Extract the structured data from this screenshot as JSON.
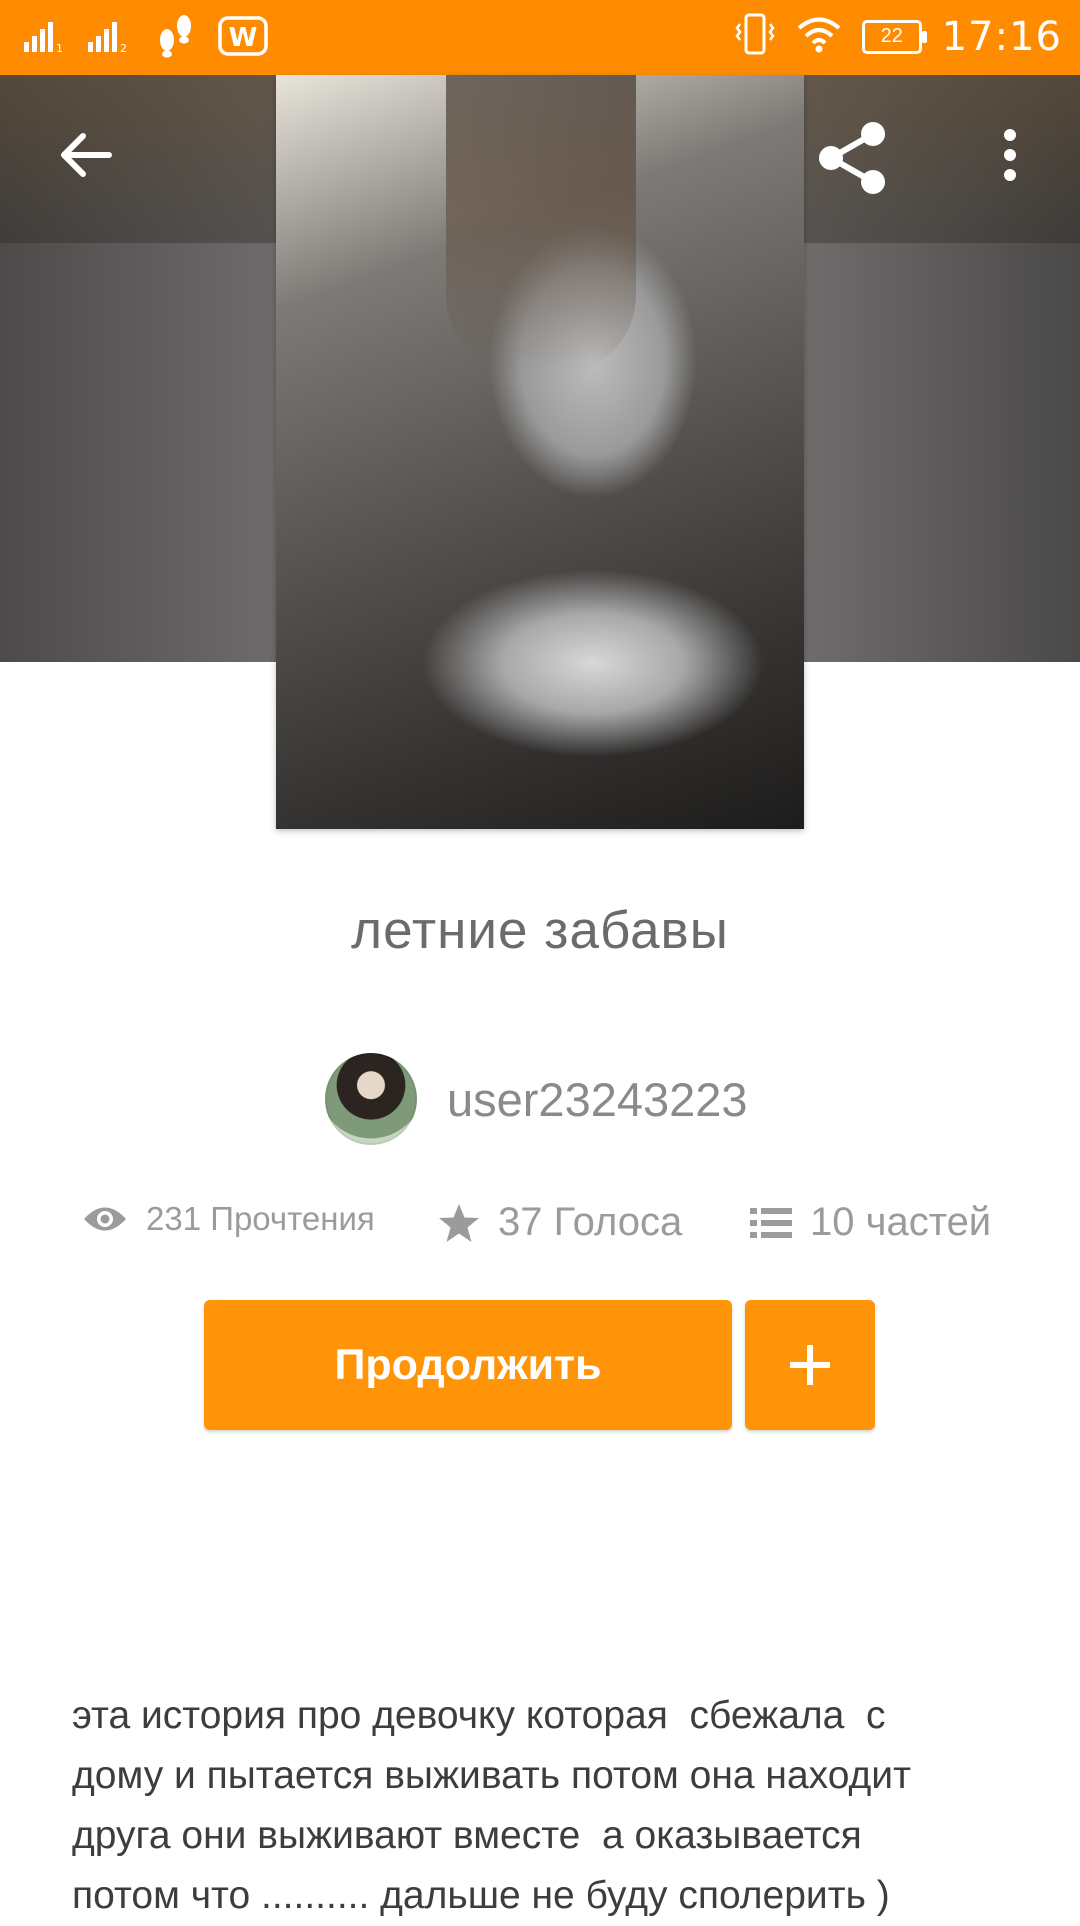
{
  "status_bar": {
    "time": "17:16",
    "battery_level": "22",
    "icons": [
      "signal-sim1-icon",
      "signal-sim2-icon",
      "footprints-icon",
      "wattpad-w-icon",
      "vibrate-icon",
      "wifi-icon",
      "battery-icon"
    ],
    "wattpad_label": "W",
    "background_color": "#ff8c00"
  },
  "toolbar": {
    "icons": [
      "back-arrow-icon",
      "share-icon",
      "more-vert-icon"
    ]
  },
  "story": {
    "title": "летние забавы",
    "author": "user23243223",
    "stats": {
      "reads": "231 Прочтения",
      "votes": "37 Голоса",
      "parts": "10 частей"
    },
    "continue_label": "Продолжить",
    "add_label": "+",
    "description": "эта история про девочку которая  сбежала  с\nдому и пытается выживать потом она находит\nдруга они выживают вместе  а оказывается\nпотом что .......... дальше не буду сполерить )"
  },
  "colors": {
    "accent": "#ff9408",
    "title_text": "#6b6b6b",
    "stats_text": "#9b9b9b"
  }
}
